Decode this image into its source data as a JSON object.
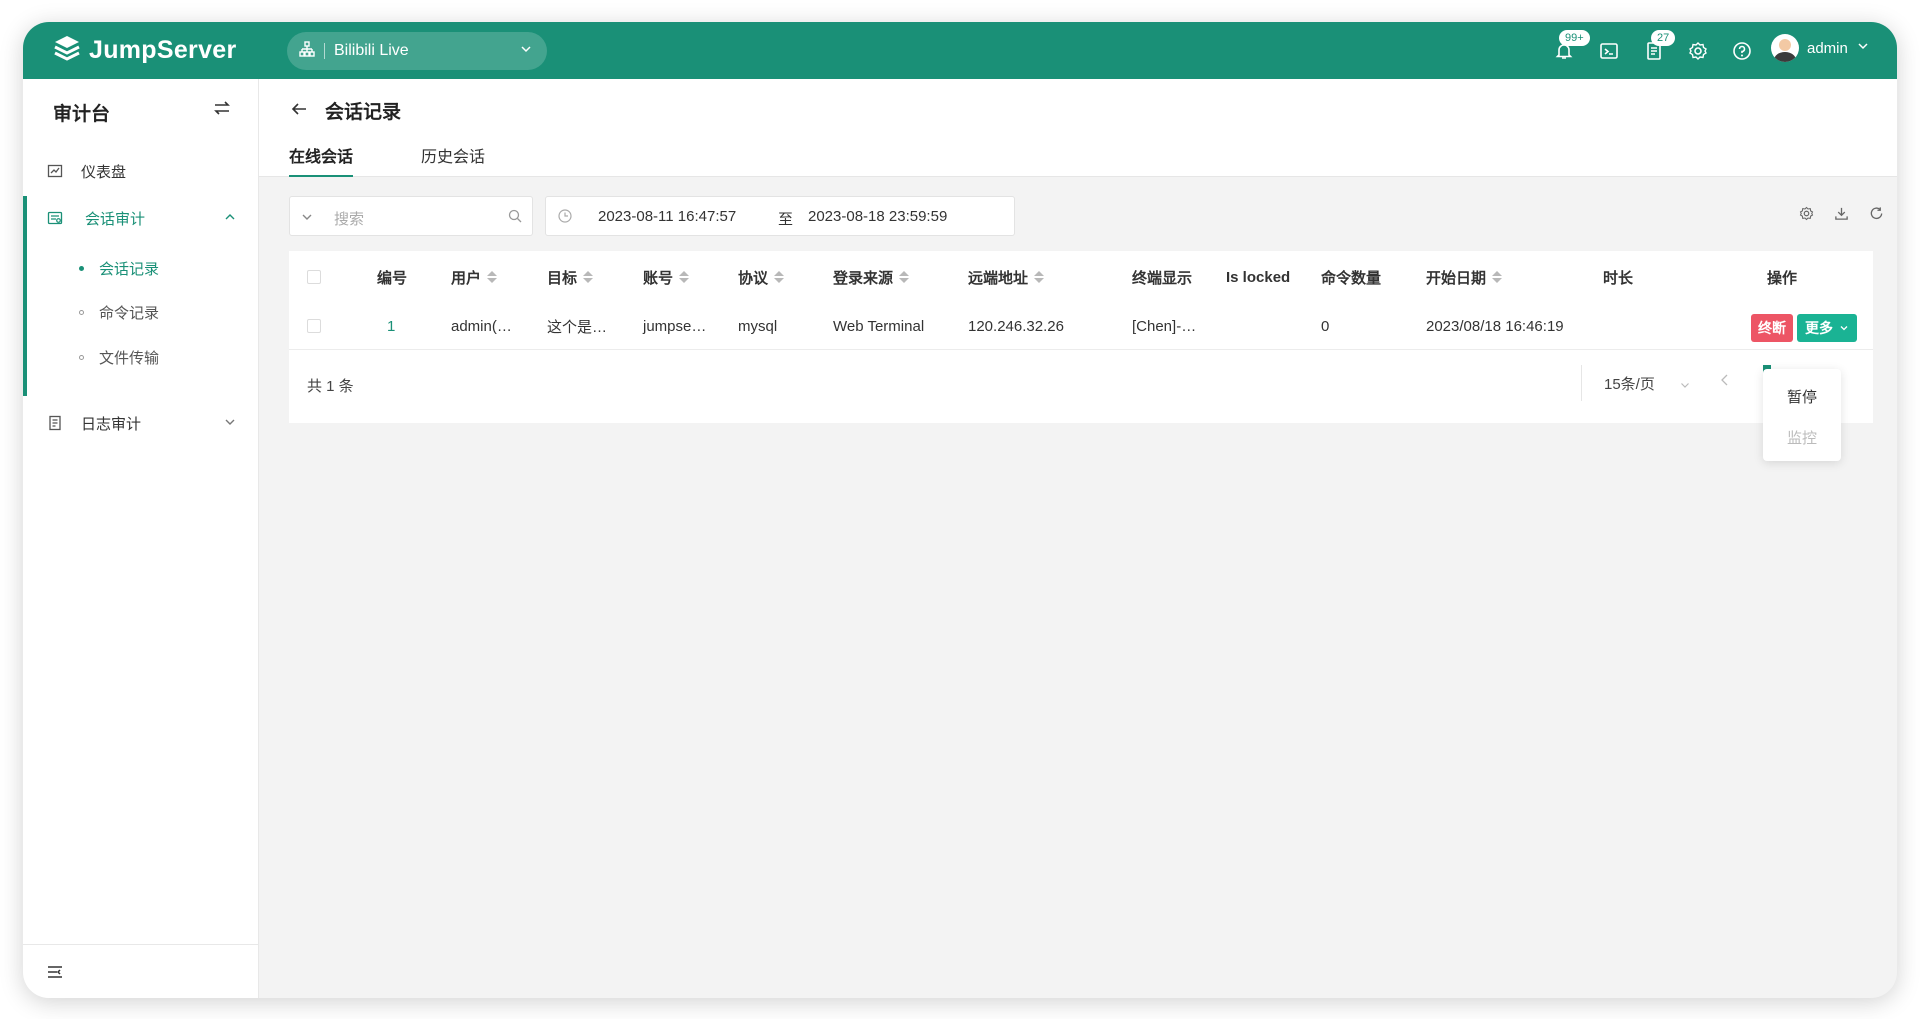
{
  "header": {
    "logo_text": "JumpServer",
    "org_name": "Bilibili Live",
    "notifications_badge": "99+",
    "tickets_badge": "27",
    "username": "admin"
  },
  "sidebar": {
    "title": "审计台",
    "items": [
      {
        "label": "仪表盘",
        "icon": "dashboard-icon"
      },
      {
        "label": "会话审计",
        "icon": "session-audit-icon",
        "expanded": true
      },
      {
        "label": "日志审计",
        "icon": "log-audit-icon",
        "expanded": false
      }
    ],
    "sub_items": [
      {
        "label": "会话记录",
        "active": true
      },
      {
        "label": "命令记录",
        "active": false
      },
      {
        "label": "文件传输",
        "active": false
      }
    ]
  },
  "page": {
    "title": "会话记录",
    "tabs": [
      {
        "label": "在线会话",
        "active": true
      },
      {
        "label": "历史会话",
        "active": false
      }
    ]
  },
  "filters": {
    "search_placeholder": "搜索",
    "date_from": "2023-08-11 16:47:57",
    "date_separator": "至",
    "date_to": "2023-08-18 23:59:59"
  },
  "table": {
    "columns": [
      "编号",
      "用户",
      "目标",
      "账号",
      "协议",
      "登录来源",
      "远端地址",
      "终端显示",
      "Is locked",
      "命令数量",
      "开始日期",
      "时长",
      "操作"
    ],
    "rows": [
      {
        "id": "1",
        "user": "admin(…",
        "target": "这个是…",
        "account": "jumpse…",
        "protocol": "mysql",
        "login_from": "Web Terminal",
        "remote_addr": "120.246.32.26",
        "terminal": "[Chen]-…",
        "is_locked": "",
        "command_count": "0",
        "date_start": "2023/08/18 16:46:19",
        "duration": ""
      }
    ],
    "terminate_label": "终断",
    "more_label": "更多"
  },
  "pagination": {
    "total_text": "共 1 条",
    "page_size": "15条/页"
  },
  "more_menu": {
    "items": [
      {
        "label": "暂停",
        "disabled": false
      },
      {
        "label": "监控",
        "disabled": true
      }
    ]
  },
  "colors": {
    "brand": "#1a9077",
    "danger": "#ed5565",
    "primary_button": "#1ab394"
  }
}
